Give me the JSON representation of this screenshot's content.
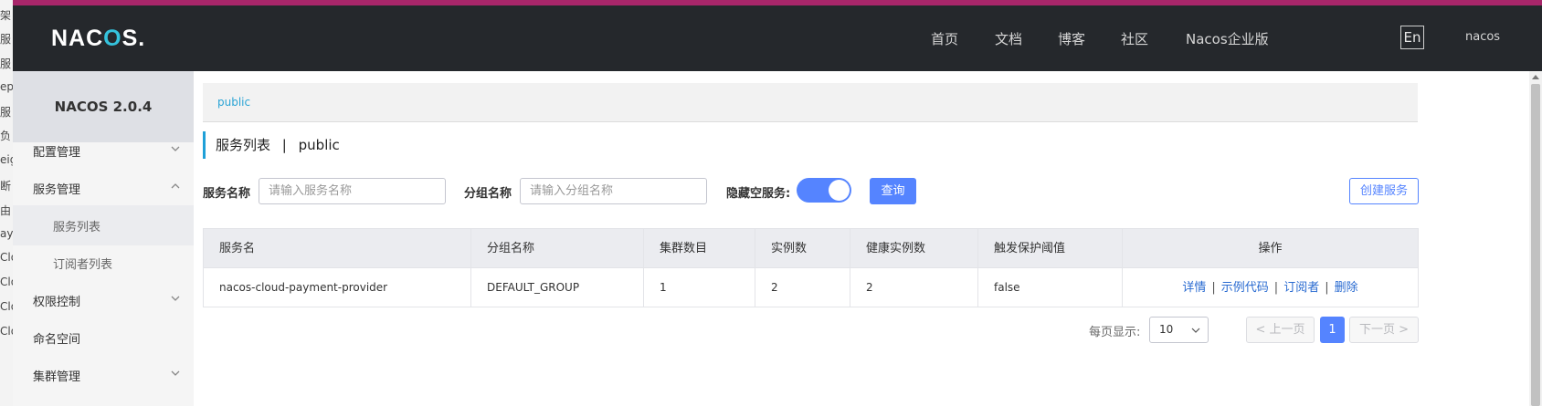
{
  "background_window": {
    "fragments": [
      "架",
      "服",
      "服",
      "ep",
      "服",
      "负",
      "eig",
      "断",
      "由",
      "ay",
      "Clo",
      "Clo",
      "Clo",
      "Clo"
    ]
  },
  "header": {
    "logo": "NACOS.",
    "nav": [
      "首页",
      "文档",
      "博客",
      "社区",
      "Nacos企业版"
    ],
    "lang": "En",
    "user": "nacos"
  },
  "sidebar": {
    "version": "NACOS 2.0.4",
    "items": [
      {
        "label": "配置管理",
        "chevron": "down"
      },
      {
        "label": "服务管理",
        "chevron": "up"
      },
      {
        "label": "服务列表",
        "sub": true,
        "active": true
      },
      {
        "label": "订阅者列表",
        "sub": true
      },
      {
        "label": "权限控制",
        "chevron": "down"
      },
      {
        "label": "命名空间"
      },
      {
        "label": "集群管理",
        "chevron": "down"
      }
    ]
  },
  "namespace_bar": {
    "current": "public"
  },
  "page": {
    "title": "服务列表",
    "separator": "|",
    "namespace": "public"
  },
  "filters": {
    "service_name_label": "服务名称",
    "service_name_placeholder": "请输入服务名称",
    "group_name_label": "分组名称",
    "group_name_placeholder": "请输入分组名称",
    "hide_empty_label": "隐藏空服务:",
    "hide_empty_on": true,
    "query_button": "查询",
    "create_button": "创建服务"
  },
  "table": {
    "headers": [
      "服务名",
      "分组名称",
      "集群数目",
      "实例数",
      "健康实例数",
      "触发保护阈值",
      "操作"
    ],
    "rows": [
      {
        "service": "nacos-cloud-payment-provider",
        "group": "DEFAULT_GROUP",
        "clusters": "1",
        "instances": "2",
        "healthy": "2",
        "threshold": "false",
        "actions": [
          "详情",
          "示例代码",
          "订阅者",
          "删除"
        ]
      }
    ]
  },
  "pagination": {
    "per_page_label": "每页显示:",
    "per_page": "10",
    "prev": "上一页",
    "current_page": "1",
    "next": "下一页"
  },
  "colors": {
    "primary": "#5584ff",
    "link": "#2a6bd1",
    "header_bg": "#25282c",
    "accent_top": "#a8266a"
  }
}
